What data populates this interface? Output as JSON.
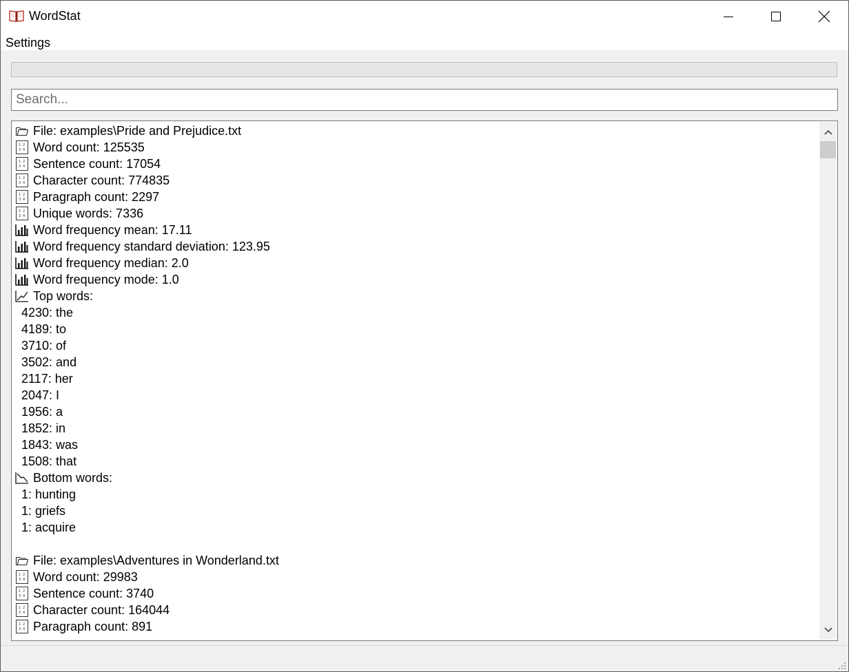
{
  "window": {
    "title": "WordStat"
  },
  "menu": {
    "settings": "Settings"
  },
  "progress": {
    "fraction": 0
  },
  "search": {
    "placeholder": "Search...",
    "value": ""
  },
  "results": [
    {
      "type": "file",
      "icon": "folder-icon",
      "text": "File: examples\\Pride and Prejudice.txt"
    },
    {
      "type": "stat",
      "icon": "number-grid-icon",
      "text": "Word count: 125535"
    },
    {
      "type": "stat",
      "icon": "number-grid-icon",
      "text": "Sentence count: 17054"
    },
    {
      "type": "stat",
      "icon": "number-grid-icon",
      "text": "Character count: 774835"
    },
    {
      "type": "stat",
      "icon": "number-grid-icon",
      "text": "Paragraph count: 2297"
    },
    {
      "type": "stat",
      "icon": "number-grid-icon",
      "text": "Unique words: 7336"
    },
    {
      "type": "stat",
      "icon": "bar-chart-icon",
      "text": "Word frequency mean: 17.11"
    },
    {
      "type": "stat",
      "icon": "bar-chart-icon",
      "text": "Word frequency standard deviation: 123.95"
    },
    {
      "type": "stat",
      "icon": "bar-chart-icon",
      "text": "Word frequency median: 2.0"
    },
    {
      "type": "stat",
      "icon": "bar-chart-icon",
      "text": "Word frequency mode: 1.0"
    },
    {
      "type": "stat",
      "icon": "trend-up-icon",
      "text": "Top words:"
    },
    {
      "type": "child",
      "text": "4230: the"
    },
    {
      "type": "child",
      "text": "4189: to"
    },
    {
      "type": "child",
      "text": "3710: of"
    },
    {
      "type": "child",
      "text": "3502: and"
    },
    {
      "type": "child",
      "text": "2117: her"
    },
    {
      "type": "child",
      "text": "2047: I"
    },
    {
      "type": "child",
      "text": "1956: a"
    },
    {
      "type": "child",
      "text": "1852: in"
    },
    {
      "type": "child",
      "text": "1843: was"
    },
    {
      "type": "child",
      "text": "1508: that"
    },
    {
      "type": "stat",
      "icon": "trend-down-icon",
      "text": "Bottom words:"
    },
    {
      "type": "child",
      "text": "1: hunting"
    },
    {
      "type": "child",
      "text": "1: griefs"
    },
    {
      "type": "child",
      "text": "1: acquire"
    },
    {
      "type": "blank"
    },
    {
      "type": "file",
      "icon": "folder-icon",
      "text": "File: examples\\Adventures in Wonderland.txt"
    },
    {
      "type": "stat",
      "icon": "number-grid-icon",
      "text": "Word count: 29983"
    },
    {
      "type": "stat",
      "icon": "number-grid-icon",
      "text": "Sentence count: 3740"
    },
    {
      "type": "stat",
      "icon": "number-grid-icon",
      "text": "Character count: 164044"
    },
    {
      "type": "stat",
      "icon": "number-grid-icon",
      "text": "Paragraph count: 891"
    }
  ]
}
